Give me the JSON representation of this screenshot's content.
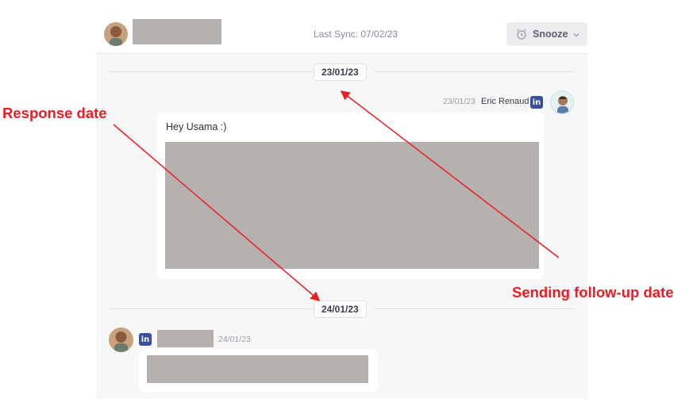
{
  "header": {
    "last_sync_label": "Last Sync: 07/02/23",
    "snooze_label": "Snooze",
    "snooze_icon": "alarm-clock-icon",
    "chevron_icon": "chevron-down-icon"
  },
  "thread": {
    "dividers": [
      "23/01/23",
      "24/01/23"
    ],
    "outgoing": {
      "date": "23/01/23",
      "sender": "Eric Renaud",
      "channel_badge": "in",
      "greeting": "Hey Usama :)"
    },
    "incoming": {
      "date": "24/01/23",
      "channel_badge": "in"
    }
  },
  "annotations": {
    "response_label": "Response date",
    "followup_label": "Sending follow-up date",
    "color": "#ec1c24"
  },
  "colors": {
    "linkedin": "#3b4fa0",
    "redaction": "#b5b1ae",
    "panel_bg": "#f7f7f7"
  }
}
